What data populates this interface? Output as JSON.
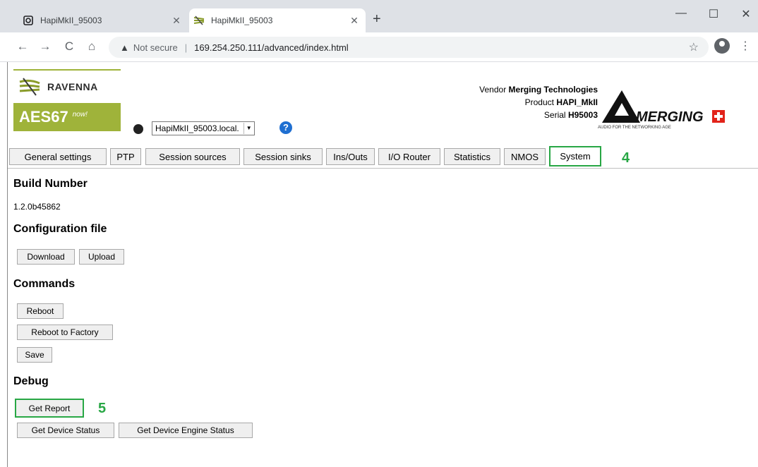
{
  "browser": {
    "tabs": [
      {
        "title": "HapiMkII_95003"
      },
      {
        "title": "HapiMkII_95003"
      }
    ],
    "address": {
      "security": "Not secure",
      "url": "169.254.250.111/advanced/index.html"
    }
  },
  "header": {
    "brand": "RAVENNA",
    "aes": "AES67",
    "aes_now": "now!",
    "host": "HapiMkII_95003.local.",
    "vendor_label": "Vendor",
    "vendor": "Merging Technologies",
    "product_label": "Product",
    "product": "HAPI_MkII",
    "serial_label": "Serial",
    "serial": "H95003",
    "merging_logo_text": "MERGING",
    "merging_tagline": "AUDIO FOR THE NETWORKING AGE"
  },
  "tabs": [
    "General settings",
    "PTP",
    "Session sources",
    "Session sinks",
    "Ins/Outs",
    "I/O Router",
    "Statistics",
    "NMOS",
    "System"
  ],
  "annotations": {
    "tab_step": "4",
    "report_step": "5"
  },
  "build": {
    "heading": "Build Number",
    "value": "1.2.0b45862"
  },
  "config": {
    "heading": "Configuration file",
    "download": "Download",
    "upload": "Upload"
  },
  "commands": {
    "heading": "Commands",
    "reboot": "Reboot",
    "reboot_factory": "Reboot to Factory",
    "save": "Save"
  },
  "debug": {
    "heading": "Debug",
    "get_report": "Get Report",
    "device_status": "Get Device Status",
    "engine_status": "Get Device Engine Status"
  },
  "colors": {
    "highlight": "#28a745",
    "ravenna_green": "#9fb33a"
  }
}
